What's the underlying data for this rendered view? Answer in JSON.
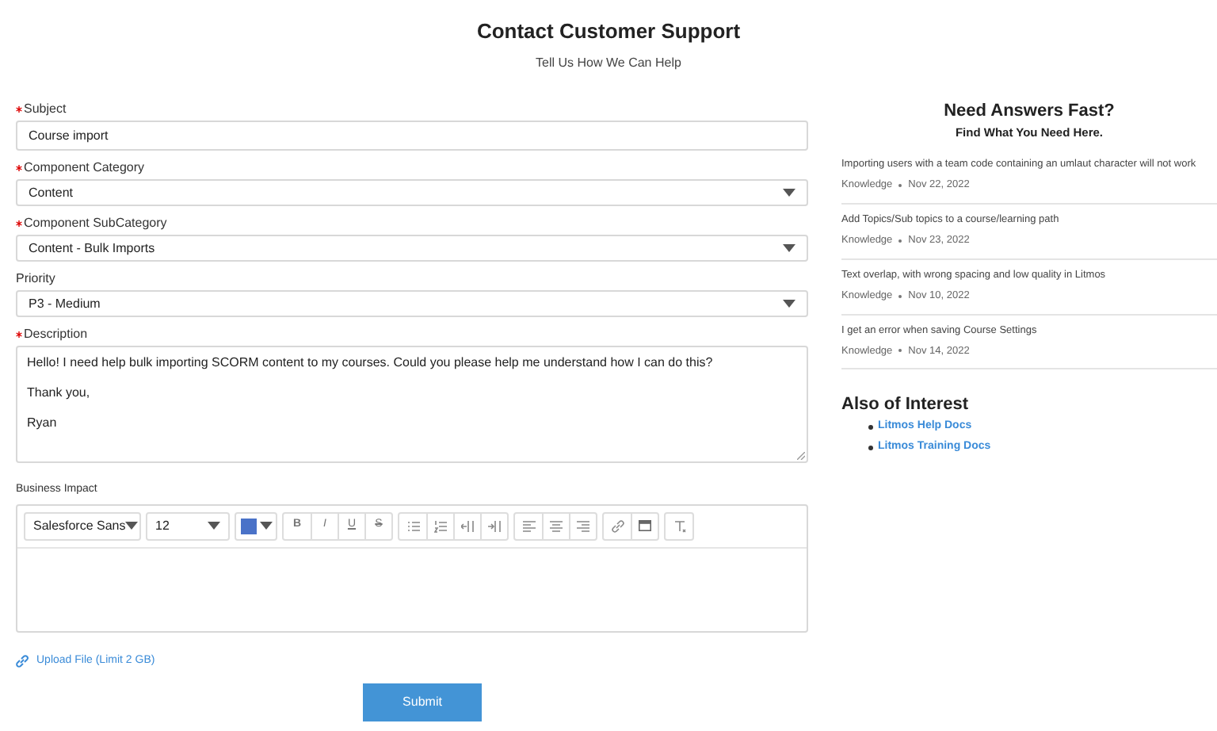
{
  "header": {
    "title": "Contact Customer Support",
    "subtitle": "Tell Us How We Can Help"
  },
  "fields": [
    {
      "kind": "text",
      "label": "Subject",
      "required": true,
      "value": "Course import"
    },
    {
      "kind": "select",
      "label": "Component Category",
      "required": true,
      "value": "Content"
    },
    {
      "kind": "select",
      "label": "Component SubCategory",
      "required": true,
      "value": "Content - Bulk Imports"
    },
    {
      "kind": "select",
      "label": "Priority",
      "required": false,
      "value": "P3 - Medium"
    }
  ],
  "description": {
    "label": "Description",
    "required": true,
    "paragraphs": [
      "Hello! I need help bulk importing SCORM content to my courses. Could you please help me understand how I can do this?",
      "Thank you,",
      "Ryan"
    ]
  },
  "business_impact": {
    "label": "Business Impact",
    "font": "Salesforce Sans",
    "size": "12",
    "format_buttons": [
      "B",
      "I",
      "U",
      "S"
    ]
  },
  "upload": {
    "label": "Upload File (Limit 2 GB)"
  },
  "submit": {
    "label": "Submit"
  },
  "answers": {
    "title": "Need Answers Fast?",
    "subtitle": "Find What You Need Here.",
    "articles": [
      {
        "title": "Importing users with a team code containing an umlaut character will not work",
        "type": "Knowledge",
        "date": "Nov 22, 2022"
      },
      {
        "title": "Add Topics/Sub topics to a course/learning path",
        "type": "Knowledge",
        "date": "Nov 23, 2022"
      },
      {
        "title": "Text overlap, with wrong spacing and low quality in Litmos",
        "type": "Knowledge",
        "date": "Nov 10, 2022"
      },
      {
        "title": "I get an error when saving Course Settings",
        "type": "Knowledge",
        "date": "Nov 14, 2022"
      }
    ]
  },
  "also_of_interest": {
    "title": "Also of Interest",
    "links": [
      "Litmos Help Docs",
      "Litmos Training Docs"
    ]
  }
}
